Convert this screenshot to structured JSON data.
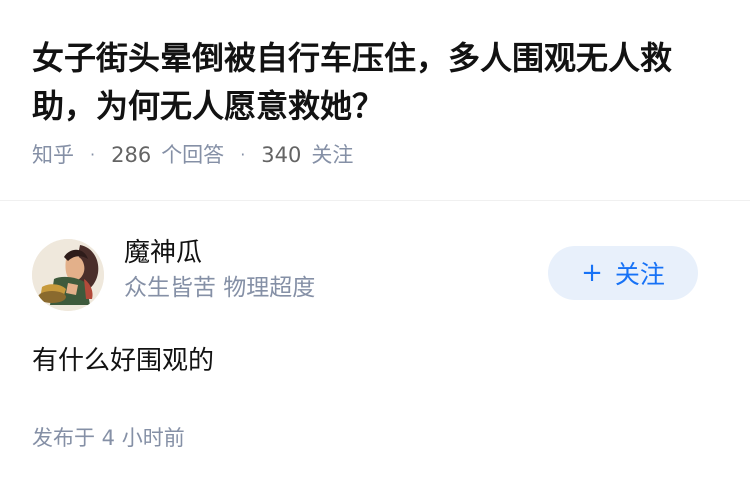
{
  "question": {
    "title": "女子街头晕倒被自行车压住，多人围观无人救助，为何无人愿意救她？",
    "source": "知乎",
    "answer_count": "286",
    "answer_label": "个回答",
    "follower_count": "340",
    "follower_label": "关注"
  },
  "answer": {
    "author": {
      "name": "魔神瓜",
      "headline": "众生皆苦 物理超度",
      "avatar_icon": "avatar-illustration"
    },
    "follow_button": {
      "icon": "plus-icon",
      "label": "关注"
    },
    "content": "有什么好围观的",
    "published": "发布于 4 小时前"
  },
  "colors": {
    "title": "#121212",
    "meta": "#8590a6",
    "accent": "#1772f6",
    "follow_bg": "#e8f0fb",
    "divider": "#f0f0f0"
  }
}
